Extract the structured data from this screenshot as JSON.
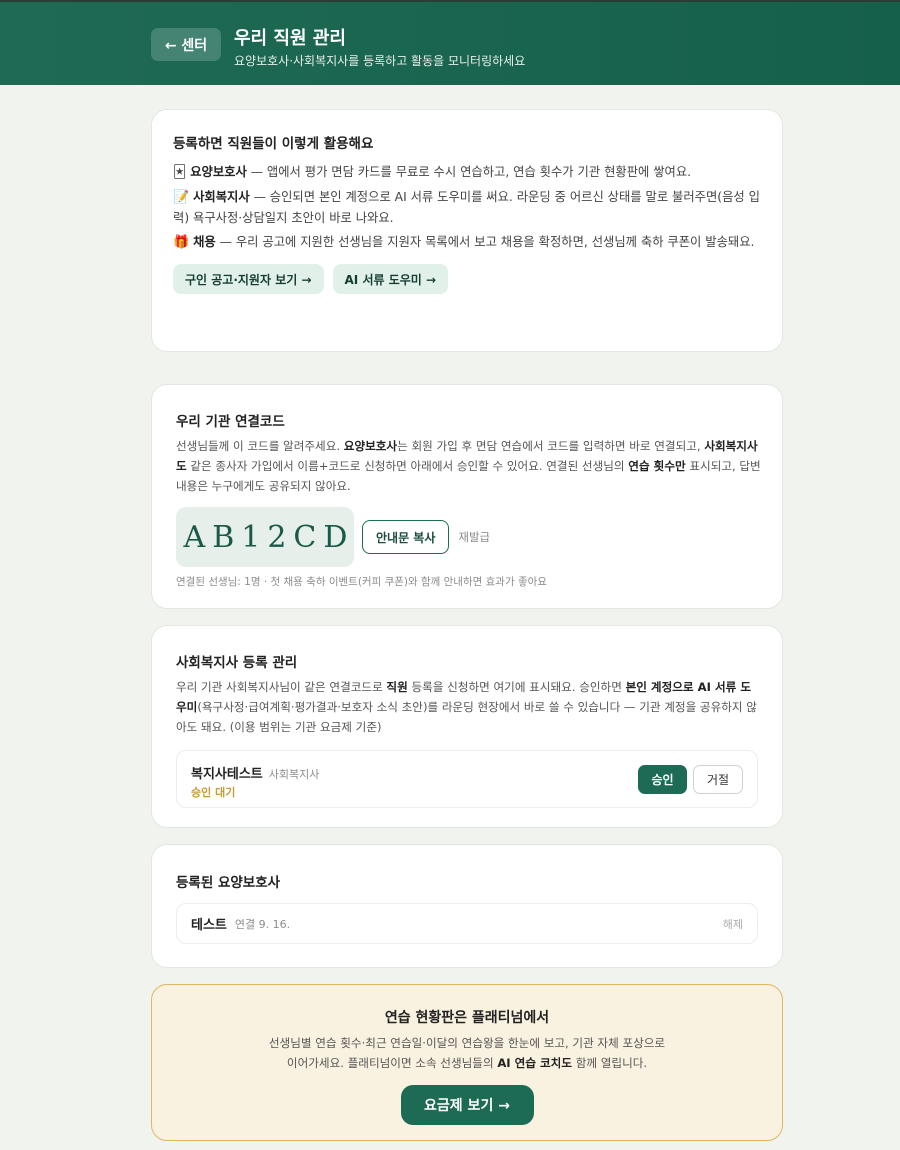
{
  "header": {
    "back_label": "← 센터",
    "title": "우리 직원 관리",
    "subtitle": "요양보호사·사회복지사를 등록하고 활동을 모니터링하세요"
  },
  "usage": {
    "title": "등록하면 직원들이 이렇게 활용해요",
    "items": [
      {
        "emoji": "🃏",
        "role": "요양보호사",
        "text": " — 앱에서 평가 면담 카드를 무료로 수시 연습하고, 연습 횟수가 기관 현황판에 쌓여요."
      },
      {
        "emoji": "📝",
        "role": "사회복지사",
        "text": " — 승인되면 본인 계정으로 AI 서류 도우미를 써요. 라운딩 중 어르신 상태를 말로 불러주면(음성 입력) 욕구사정·상담일지 초안이 바로 나와요."
      },
      {
        "emoji": "🎁",
        "role": "채용",
        "text": " — 우리 공고에 지원한 선생님을 지원자 목록에서 보고 채용을 확정하면, 선생님께 축하 쿠폰이 발송돼요."
      }
    ],
    "link_jobs": "구인 공고·지원자 보기 →",
    "link_ai": "AI 서류 도우미 →"
  },
  "code": {
    "title": "우리 기관 연결코드",
    "desc_1": "선생님들께 이 코드를 알려주세요. ",
    "desc_b1": "요양보호사",
    "desc_2": "는 회원 가입 후 면담 연습에서 코드를 입력하면 바로 연결되고, ",
    "desc_b2": "사회복지사도",
    "desc_3": " 같은 종사자 가입에서 이름+코드로 신청하면 아래에서 승인할 수 있어요. 연결된 선생님의 ",
    "desc_b3": "연습 횟수만",
    "desc_4": " 표시되고, 답변 내용은 누구에게도 공유되지 않아요.",
    "value": "AB12CD",
    "copy_label": "안내문 복사",
    "reissue_label": "재발급",
    "footnote": "연결된 선생님: 1명 · 첫 채용 축하 이벤트(커피 쿠폰)와 함께 안내하면 효과가 좋아요"
  },
  "social": {
    "title": "사회복지사 등록 관리",
    "desc_1": "우리 기관 사회복지사님이 같은 연결코드로 ",
    "desc_b1": "직원",
    "desc_2": " 등록을 신청하면 여기에 표시돼요. 승인하면 ",
    "desc_b2": "본인 계정으로 AI 서류 도우미",
    "desc_3": "(욕구사정·급여계획·평가결과·보호자 소식 초안)를 라운딩 현장에서 바로 쓸 수 있습니다 — 기관 계정을 공유하지 않아도 돼요. (이용 범위는 기관 요금제 기준)",
    "entry": {
      "name": "복지사테스트",
      "role": "사회복지사",
      "status": "승인 대기",
      "approve": "승인",
      "reject": "거절"
    }
  },
  "caregivers": {
    "title": "등록된 요양보호사",
    "entry": {
      "name": "테스트",
      "date": "연결 9. 16.",
      "remove": "해제"
    }
  },
  "platinum": {
    "title": "연습 현황판은 플래티넘에서",
    "desc_1": "선생님별 연습 횟수·최근 연습일·이달의 연습왕을 한눈에 보고, 기관 자체 포상으로",
    "desc_2": "이어가세요. 플래티넘이면 소속 선생님들의 ",
    "desc_b": "AI 연습 코치도",
    "desc_3": " 함께 열립니다.",
    "button": "요금제 보기 →"
  },
  "colors": {
    "brand": "#1e6b55",
    "warning": "#c79a3c",
    "platinum_bg": "#faf2e1"
  }
}
